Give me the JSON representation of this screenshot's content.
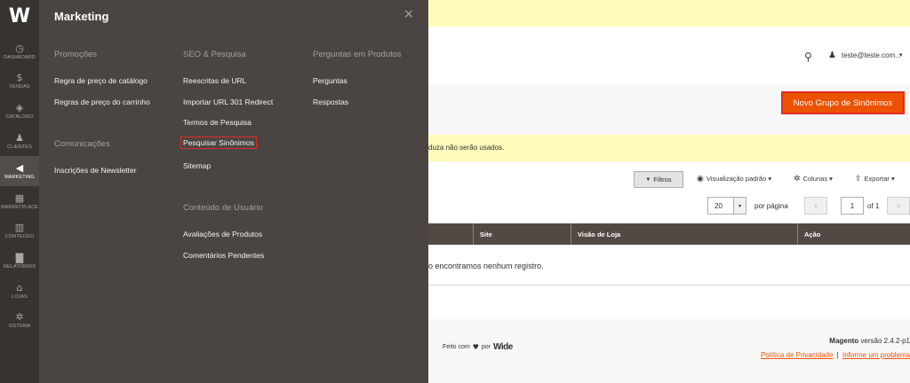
{
  "navbar": {
    "logo": "W",
    "items": [
      {
        "label": "Dashboard",
        "icon": "dashboard-icon",
        "glyph": "◷"
      },
      {
        "label": "Vendas",
        "icon": "dollar-icon",
        "glyph": "$"
      },
      {
        "label": "Catálogo",
        "icon": "cube-icon",
        "glyph": "◈"
      },
      {
        "label": "Clientes",
        "icon": "person-icon",
        "glyph": "♟"
      },
      {
        "label": "Marketing",
        "icon": "megaphone-icon",
        "glyph": "◀"
      },
      {
        "label": "Marketplace",
        "icon": "store-icon",
        "glyph": "▦"
      },
      {
        "label": "Conteúdo",
        "icon": "layout-icon",
        "glyph": "▥"
      },
      {
        "label": "Relatórios",
        "icon": "bar-chart-icon",
        "glyph": "▇"
      },
      {
        "label": "Lojas",
        "icon": "shop-icon",
        "glyph": "⌂"
      },
      {
        "label": "Sistema",
        "icon": "gear-icon",
        "glyph": "✲"
      }
    ]
  },
  "menu": {
    "title": "Marketing",
    "close": "×",
    "promocoes": {
      "heading": "Promoções",
      "links": [
        "Regra de preço de catálogo",
        "Regras de preço do carrinho"
      ]
    },
    "comunicacoes": {
      "heading": "Comunicações",
      "links": [
        "Inscrições de Newsletter"
      ]
    },
    "seo": {
      "heading": "SEO & Pesquisa",
      "links": [
        "Reescritas de URL",
        "Importar URL 301 Redirect",
        "Termos de Pesquisa",
        "Pesquisar Sinônimos",
        "Sitemap"
      ]
    },
    "conteudo": {
      "heading": "Conteúdo de Usuário",
      "links": [
        "Avaliações de Produtos",
        "Comentários Pendentes"
      ]
    },
    "perguntas": {
      "heading": "Perguntas em Produtos",
      "links": [
        "Perguntas",
        "Respostas"
      ]
    }
  },
  "header": {
    "user": "teste@teste.com...",
    "caret": "▾",
    "search_glyph": "⚲",
    "user_glyph": "♟"
  },
  "actions": {
    "new_button": "Novo Grupo de Sinônimos"
  },
  "message": {
    "text": "duza não serão usados."
  },
  "grid": {
    "filters": "Filtros",
    "filter_glyph": "▼",
    "view": "Visualização padrão",
    "columns": "Colunas",
    "export": "Exportar",
    "page_size": "20",
    "per_page": "por página",
    "page": "1",
    "of_pages": "of 1",
    "prev": "‹",
    "next": "›",
    "columns_headers": [
      "",
      "Site",
      "Visão de Loja",
      "Ação"
    ],
    "empty": "o encontramos nenhum registro."
  },
  "footer": {
    "made_with": "Feito com",
    "by": "por",
    "brand": "Wide",
    "heart": "♥",
    "magento": "Magento",
    "version": "versão 2.4.2-p1",
    "privacy": "Política de Privacidade",
    "separator": "|",
    "report": "Informe um problema"
  },
  "colors": {
    "accent": "#eb5202",
    "highlight_border": "#e02b27",
    "menu_bg": "#4a4542",
    "navbar_bg": "#373330",
    "grid_header_bg": "#514943",
    "notice_bg": "#fffbbb"
  }
}
